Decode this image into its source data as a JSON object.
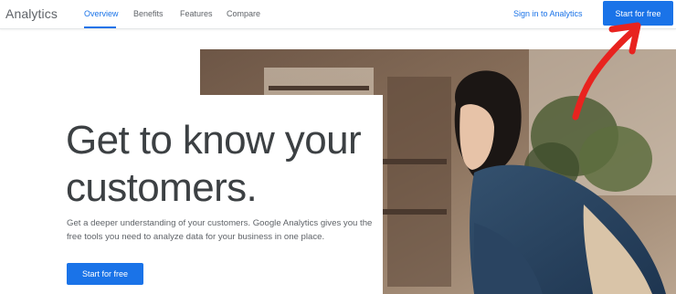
{
  "brand": "Analytics",
  "nav": {
    "tabs": [
      {
        "label": "Overview",
        "active": true
      },
      {
        "label": "Benefits",
        "active": false
      },
      {
        "label": "Features",
        "active": false
      },
      {
        "label": "Compare",
        "active": false
      }
    ],
    "sign_in": "Sign in to Analytics",
    "start_free": "Start for free"
  },
  "hero": {
    "headline": "Get to know your customers.",
    "description": "Get a deeper understanding of your customers. Google Analytics gives you the free tools you need to analyze data for your business in one place.",
    "cta": "Start for free"
  },
  "colors": {
    "accent": "#1a73e8",
    "headline": "#3c4043",
    "muted": "#5f6368",
    "annotation_arrow": "#e8231f"
  },
  "icons": {
    "annotation": "red-arrow-icon"
  }
}
